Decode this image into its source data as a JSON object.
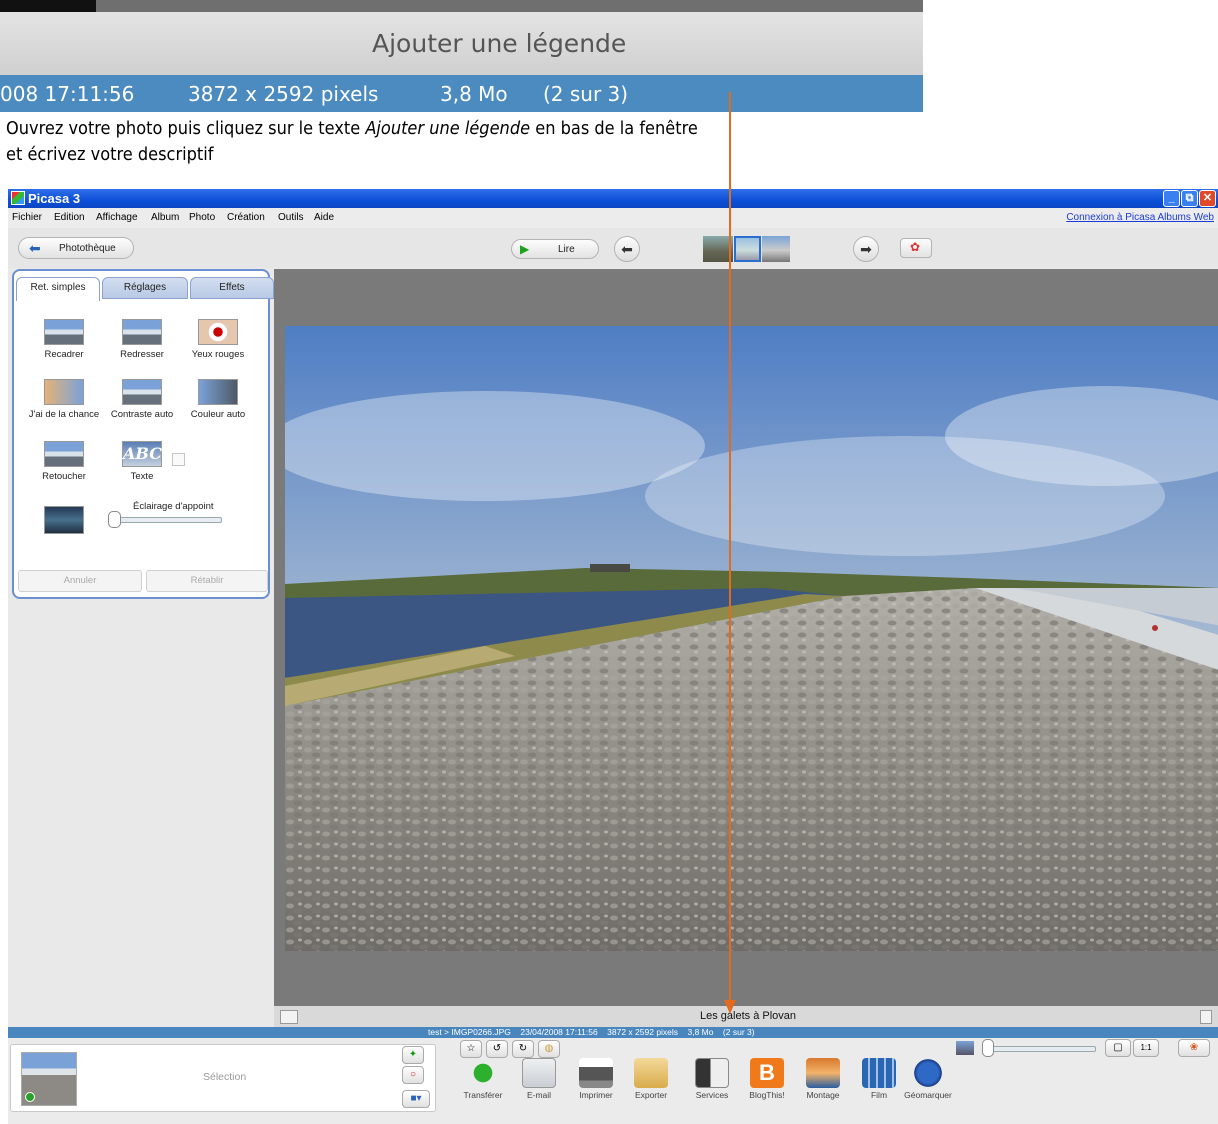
{
  "zoom": {
    "caption": "Ajouter une légende",
    "status": {
      "time": "008 17:11:56",
      "pixels": "3872 x 2592 pixels",
      "size": "3,8 Mo",
      "index": "(2 sur 3)"
    }
  },
  "instruction": {
    "pre": "Ouvrez votre photo puis cliquez sur le texte",
    "emph": "Ajouter une légende",
    "post": "en bas de  la fenêtre",
    "line2": "et écrivez votre descriptif"
  },
  "window": {
    "title": "Picasa 3",
    "controls": {
      "minimize": "_",
      "restore": "⧉",
      "close": "✕"
    }
  },
  "menu": {
    "items": [
      "Fichier",
      "Edition",
      "Affichage",
      "Album",
      "Photo",
      "Création",
      "Outils",
      "Aide"
    ],
    "link": "Connexion à Picasa Albums Web"
  },
  "toolbar": {
    "library": "Photothèque",
    "play": "Lire"
  },
  "panel": {
    "tabs": [
      "Ret. simples",
      "Réglages",
      "Effets"
    ],
    "tools": [
      "Recadrer",
      "Redresser",
      "Yeux rouges",
      "J'ai de la chance",
      "Contraste auto",
      "Couleur auto",
      "Retoucher",
      "Texte"
    ],
    "fill_light": "Éclairage d'appoint",
    "undo": "Annuler",
    "redo": "Rétablir"
  },
  "caption_text": "Les galets à Plovan",
  "status": "test > IMGP0266.JPG    23/04/2008 17:11:56    3872 x 2592 pixels    3,8 Mo    (2 sur 3)",
  "tray": {
    "selection": "Sélection",
    "actions": [
      "Transférer",
      "E-mail",
      "Imprimer",
      "Exporter",
      "Services",
      "BlogThis!",
      "Montage",
      "Film",
      "Géomarquer"
    ]
  },
  "colors": {
    "arrow": "#e36b1e",
    "status_blue": "#4a86be",
    "titlebar": "#0c4fd8"
  }
}
